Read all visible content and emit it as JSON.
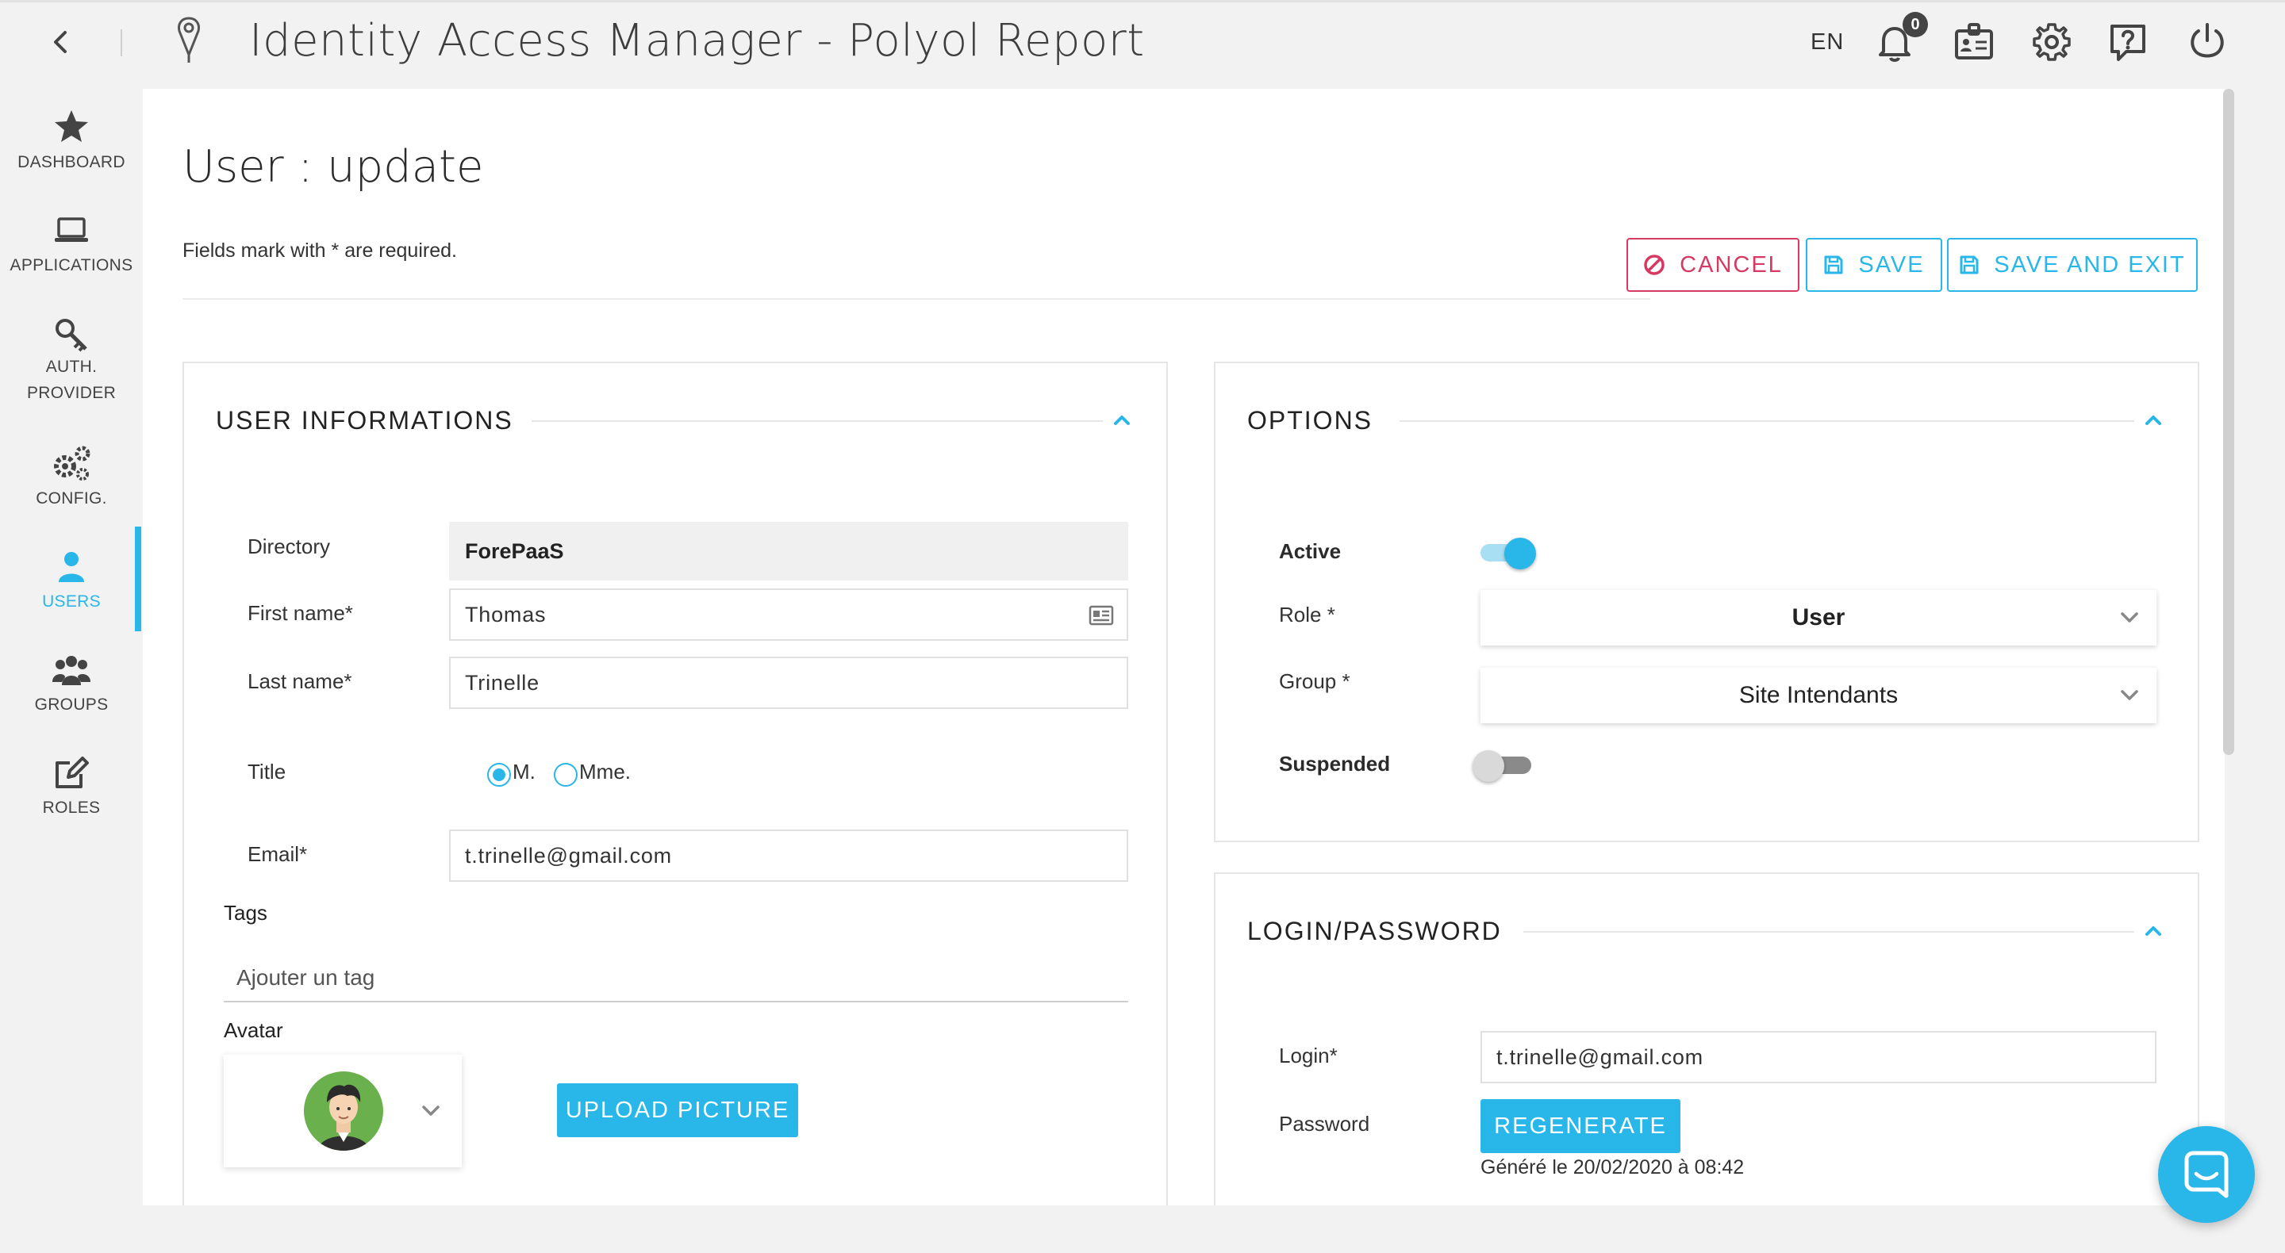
{
  "header": {
    "app_title": "Identity Access Manager - Polyol Report",
    "language": "EN",
    "notification_count": "0",
    "icons": [
      "back-arrow-icon",
      "logo-pin-icon",
      "bell-icon",
      "id-card-icon",
      "gear-icon",
      "help-icon",
      "power-icon"
    ]
  },
  "sidebar": {
    "items": [
      {
        "label": "DASHBOARD",
        "icon": "star-icon",
        "active": false
      },
      {
        "label": "APPLICATIONS",
        "icon": "laptop-icon",
        "active": false
      },
      {
        "label_line1": "AUTH.",
        "label_line2": "PROVIDER",
        "icon": "key-icon",
        "active": false
      },
      {
        "label": "CONFIG.",
        "icon": "gears-icon",
        "active": false
      },
      {
        "label": "USERS",
        "icon": "user-icon",
        "active": true
      },
      {
        "label": "GROUPS",
        "icon": "users-icon",
        "active": false
      },
      {
        "label": "ROLES",
        "icon": "edit-icon",
        "active": false
      }
    ]
  },
  "page": {
    "title": "User : update",
    "required_note": "Fields mark with * are required.",
    "actions": {
      "cancel": "CANCEL",
      "save": "SAVE",
      "save_exit": "SAVE AND EXIT"
    }
  },
  "user_info": {
    "title": "USER INFORMATIONS",
    "directory_label": "Directory",
    "directory_value": "ForePaaS",
    "first_name_label": "First name*",
    "first_name_value": "Thomas",
    "last_name_label": "Last name*",
    "last_name_value": "Trinelle",
    "title_label": "Title",
    "title_options": [
      "M.",
      "Mme."
    ],
    "title_selected": "M.",
    "email_label": "Email*",
    "email_value": "t.trinelle@gmail.com",
    "tags_label": "Tags",
    "tags_placeholder": "Ajouter un tag",
    "avatar_label": "Avatar",
    "upload_button": "UPLOAD PICTURE"
  },
  "options": {
    "title": "OPTIONS",
    "active_label": "Active",
    "active": true,
    "role_label": "Role *",
    "role_value": "User",
    "group_label": "Group *",
    "group_value": "Site Intendants",
    "suspended_label": "Suspended",
    "suspended": false
  },
  "login": {
    "title": "LOGIN/PASSWORD",
    "login_label": "Login*",
    "login_value": "t.trinelle@gmail.com",
    "password_label": "Password",
    "regenerate_button": "REGENERATE",
    "generated_note": "Généré le 20/02/2020 à 08:42"
  },
  "colors": {
    "accent": "#29b6e8",
    "danger": "#d63a63",
    "background": "#f2f2f2"
  }
}
